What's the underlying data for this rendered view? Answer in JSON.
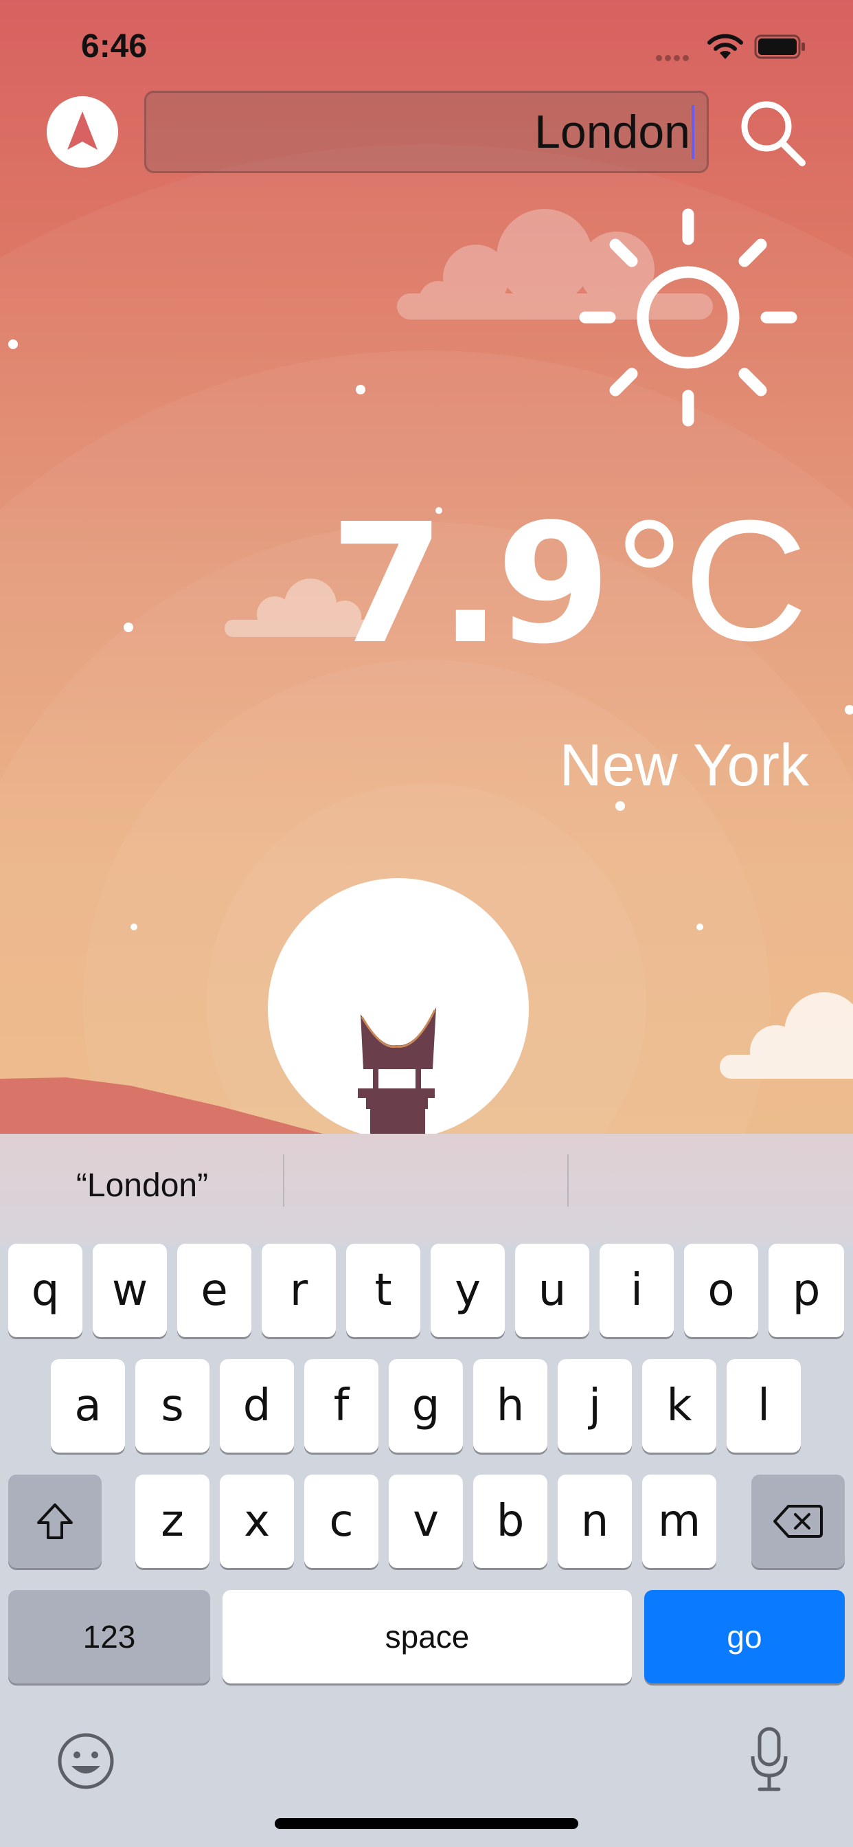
{
  "status_bar": {
    "time": "6:46"
  },
  "search": {
    "value": "London",
    "placeholder": ""
  },
  "weather": {
    "temperature": "7.9",
    "unit": "°C",
    "city": "New York"
  },
  "keyboard": {
    "suggestions": [
      "“London”",
      "",
      ""
    ],
    "row1": [
      "q",
      "w",
      "e",
      "r",
      "t",
      "y",
      "u",
      "i",
      "o",
      "p"
    ],
    "row2": [
      "a",
      "s",
      "d",
      "f",
      "g",
      "h",
      "j",
      "k",
      "l"
    ],
    "row3": [
      "z",
      "x",
      "c",
      "v",
      "b",
      "n",
      "m"
    ],
    "numbers_label": "123",
    "space_label": "space",
    "go_label": "go"
  },
  "colors": {
    "go_key": "#0a7aff",
    "sky_top": "#d76160",
    "sky_bottom": "#ecb37b"
  },
  "icons": [
    "location-arrow-icon",
    "search-icon",
    "sun-icon",
    "shift-icon",
    "delete-icon",
    "emoji-icon",
    "microphone-icon",
    "wifi-icon",
    "battery-icon"
  ]
}
